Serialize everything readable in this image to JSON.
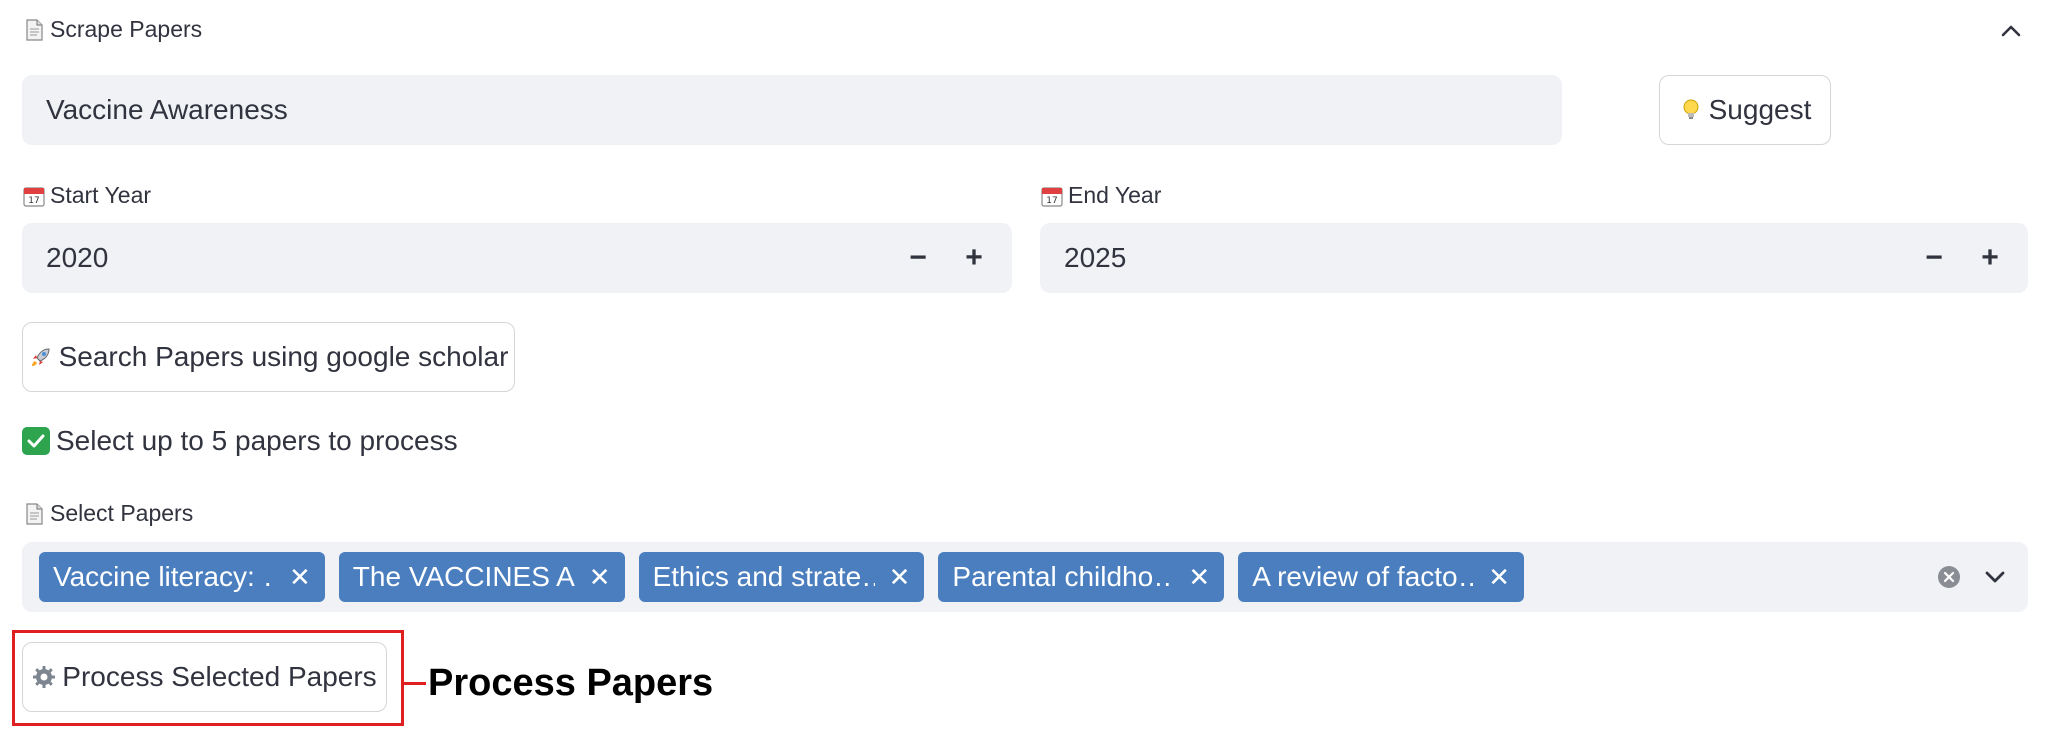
{
  "section": {
    "title": "Scrape Papers",
    "title_icon": "page-facing-up-icon",
    "collapse_icon": "chevron-up-icon"
  },
  "topic_input": {
    "value": "Vaccine Awareness"
  },
  "suggest_button": {
    "label": "Suggest",
    "icon": "light-bulb-icon"
  },
  "start_year": {
    "label": "Start Year",
    "icon": "calendar-icon",
    "value": "2020",
    "minus": "−",
    "plus": "+"
  },
  "end_year": {
    "label": "End Year",
    "icon": "calendar-icon",
    "value": "2025",
    "minus": "−",
    "plus": "+"
  },
  "search_button": {
    "label": "Search Papers using google scholar",
    "icon": "rocket-icon"
  },
  "select_info": {
    "text": "Select up to 5 papers to process",
    "icon": "check-mark-icon",
    "icon_color": "#2ea44f"
  },
  "select_papers": {
    "label": "Select Papers",
    "icon": "page-facing-up-icon",
    "chips": [
      {
        "label": "Vaccine literacy: …"
      },
      {
        "label": "The VACCINES A…"
      },
      {
        "label": "Ethics and strate…"
      },
      {
        "label": "Parental childho…"
      },
      {
        "label": "A review of facto…"
      }
    ],
    "chip_color": "#4a7ebf",
    "clear_icon": "clear-circle-icon",
    "dropdown_icon": "chevron-down-icon"
  },
  "process_button": {
    "label": "Process Selected Papers",
    "icon": "gear-icon"
  },
  "annotation": {
    "text": "Process Papers",
    "color": "#e02020"
  }
}
